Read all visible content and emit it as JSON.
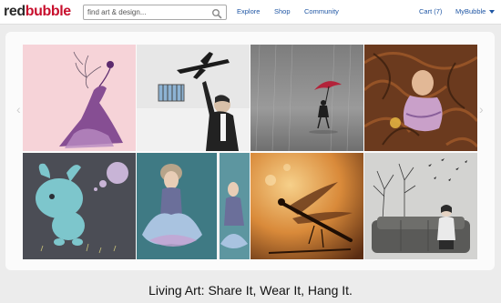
{
  "brand": {
    "part1": "red",
    "part2": "bubble"
  },
  "search": {
    "placeholder": "find art & design..."
  },
  "nav": {
    "explore": "Explore",
    "shop": "Shop",
    "community": "Community",
    "cart": "Cart (7)",
    "mybubble": "MyBubble"
  },
  "gallery": {
    "prev_arrow": "‹",
    "next_arrow": "›"
  },
  "tagline": "Living Art: Share It, Wear It, Hang It.",
  "colors": {
    "brand_red": "#c8102e",
    "link_blue": "#1f56a4"
  }
}
